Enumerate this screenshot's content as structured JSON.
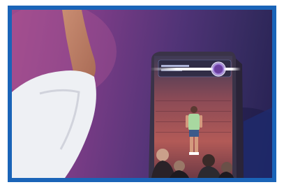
{
  "photo": {
    "description_alt": "",
    "device_screen_text": "",
    "colors": {
      "frame_border": "#1a64b8",
      "background_magenta": "#9c4a8c",
      "background_purple": "#4f3376",
      "background_dark": "#262052",
      "sleeve_white": "#eef0f4",
      "skin": "#d49a7e",
      "device_body": "#3a3348",
      "device_screen": "#b25a57",
      "avatar_shirt": "#a8d8a0",
      "avatar_pants": "#3c5a8a",
      "ring_glow": "#ffffff"
    }
  }
}
